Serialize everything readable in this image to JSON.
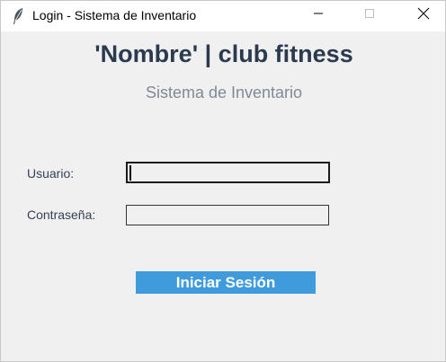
{
  "window": {
    "title": "Login - Sistema de Inventario",
    "icon": "feather-icon",
    "controls": [
      "minimize-icon",
      "maximize-icon",
      "close-icon"
    ]
  },
  "header": {
    "title": "'Nombre' | club fitness",
    "subtitle": "Sistema de Inventario"
  },
  "form": {
    "username_label": "Usuario:",
    "username_value": "",
    "password_label": "Contraseña:",
    "password_value": "",
    "submit_label": "Iniciar Sesión"
  },
  "colors": {
    "accent": "#3f9bdc",
    "heading": "#2b3a4f",
    "subtitle": "#808a94",
    "background": "#f0f0f0"
  }
}
